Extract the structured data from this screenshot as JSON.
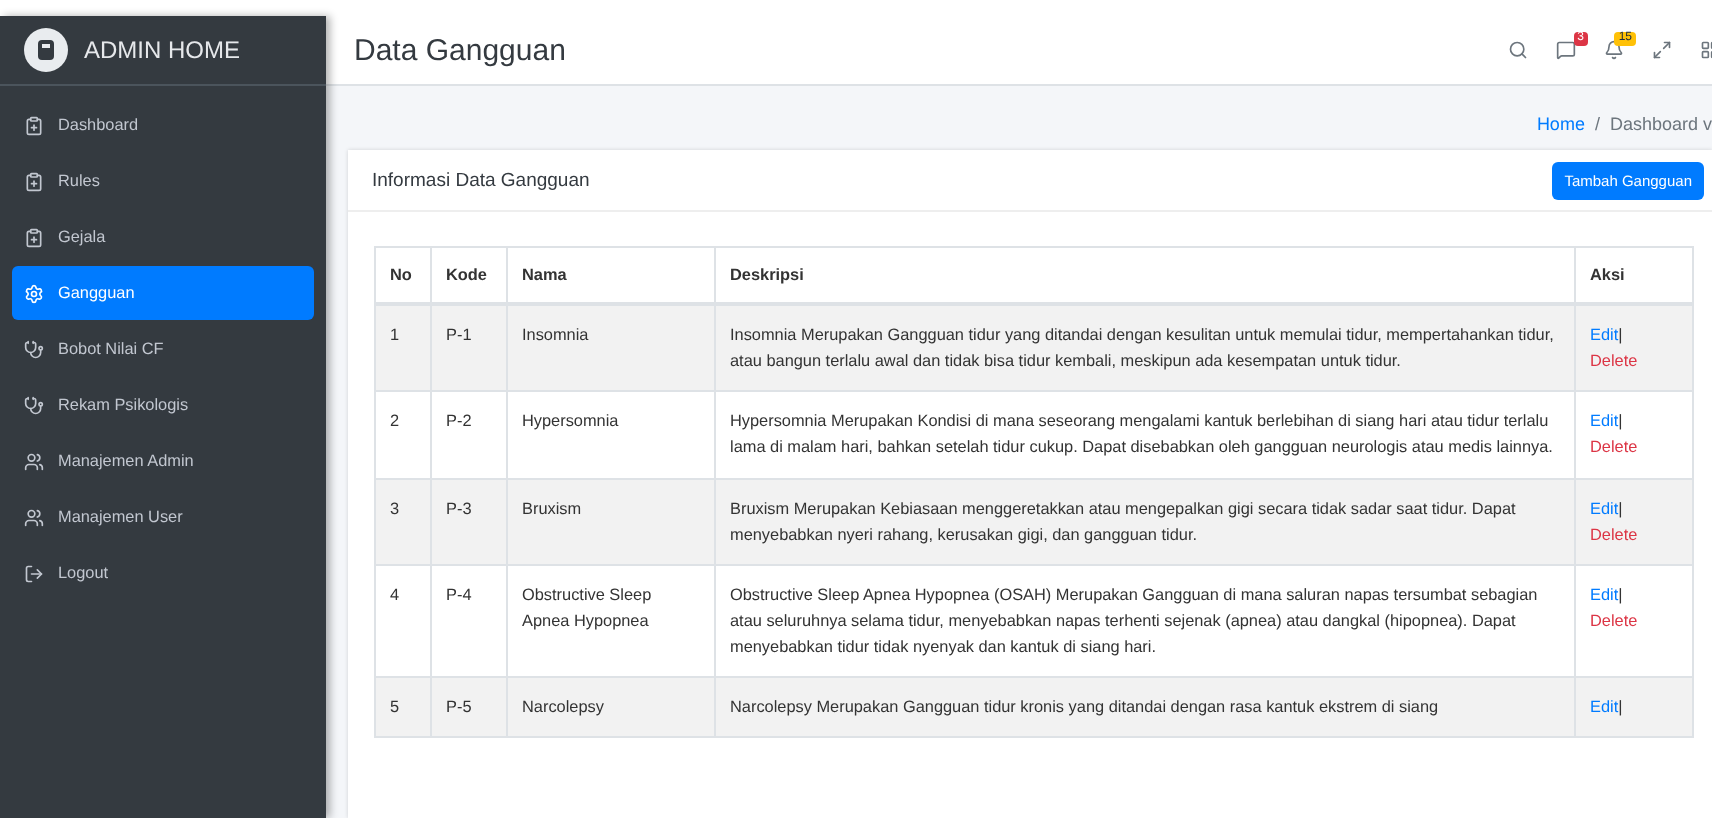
{
  "sidebar": {
    "brand": "ADMIN HOME",
    "items": [
      {
        "label": "Dashboard",
        "kind": "clipboard",
        "selected": false
      },
      {
        "label": "Rules",
        "kind": "clipboard",
        "selected": false
      },
      {
        "label": "Gejala",
        "kind": "clipboard",
        "selected": false
      },
      {
        "label": "Gangguan",
        "kind": "gear",
        "selected": true
      },
      {
        "label": "Bobot Nilai CF",
        "kind": "stethoscope",
        "selected": false
      },
      {
        "label": "Rekam Psikologis",
        "kind": "stethoscope",
        "selected": false
      },
      {
        "label": "Manajemen Admin",
        "kind": "users",
        "selected": false
      },
      {
        "label": "Manajemen User",
        "kind": "users",
        "selected": false
      },
      {
        "label": "Logout",
        "kind": "logout",
        "selected": false
      }
    ]
  },
  "header": {
    "title": "Data Gangguan",
    "messages_badge": "3",
    "notifications_badge": "15"
  },
  "breadcrumb": {
    "link": "Home",
    "separator": "/",
    "current": "Dashboard v"
  },
  "card": {
    "title": "Informasi Data Gangguan",
    "button": "Tambah Gangguan"
  },
  "table": {
    "columns": [
      "No",
      "Kode",
      "Nama",
      "Deskripsi",
      "Aksi"
    ],
    "rows": [
      {
        "no": "1",
        "kode": "P-1",
        "nama": "Insomnia",
        "deskripsi": "Insomnia Merupakan Gangguan tidur yang ditandai dengan kesulitan untuk memulai tidur, mempertahankan tidur, atau bangun terlalu awal dan tidak bisa tidur kembali, meskipun ada kesempatan untuk tidur.",
        "edit": "Edit",
        "separator": "|",
        "delete": "Delete"
      },
      {
        "no": "2",
        "kode": "P-2",
        "nama": "Hypersomnia",
        "deskripsi": "Hypersomnia Merupakan Kondisi di mana seseorang mengalami kantuk berlebihan di siang hari atau tidur terlalu lama di malam hari, bahkan setelah tidur cukup. Dapat disebabkan oleh gangguan neurologis atau medis lainnya.",
        "edit": "Edit",
        "separator": "|",
        "delete": "Delete"
      },
      {
        "no": "3",
        "kode": "P-3",
        "nama": "Bruxism",
        "deskripsi": "Bruxism Merupakan Kebiasaan menggeretakkan atau mengepalkan gigi secara tidak sadar saat tidur. Dapat menyebabkan nyeri rahang, kerusakan gigi, dan gangguan tidur.",
        "edit": "Edit",
        "separator": "|",
        "delete": "Delete"
      },
      {
        "no": "4",
        "kode": "P-4",
        "nama": "Obstructive Sleep Apnea Hypopnea",
        "deskripsi": "Obstructive Sleep Apnea Hypopnea (OSAH) Merupakan Gangguan di mana saluran napas tersumbat sebagian atau seluruhnya selama tidur, menyebabkan napas terhenti sejenak (apnea) atau dangkal (hipopnea). Dapat menyebabkan tidur tidak nyenyak dan kantuk di siang hari.",
        "edit": "Edit",
        "separator": "|",
        "delete": "Delete"
      },
      {
        "no": "5",
        "kode": "P-5",
        "nama": "Narcolepsy",
        "deskripsi": "Narcolepsy Merupakan Gangguan tidur kronis yang ditandai dengan rasa kantuk ekstrem di siang",
        "edit": "Edit",
        "separator": "|"
      }
    ]
  }
}
